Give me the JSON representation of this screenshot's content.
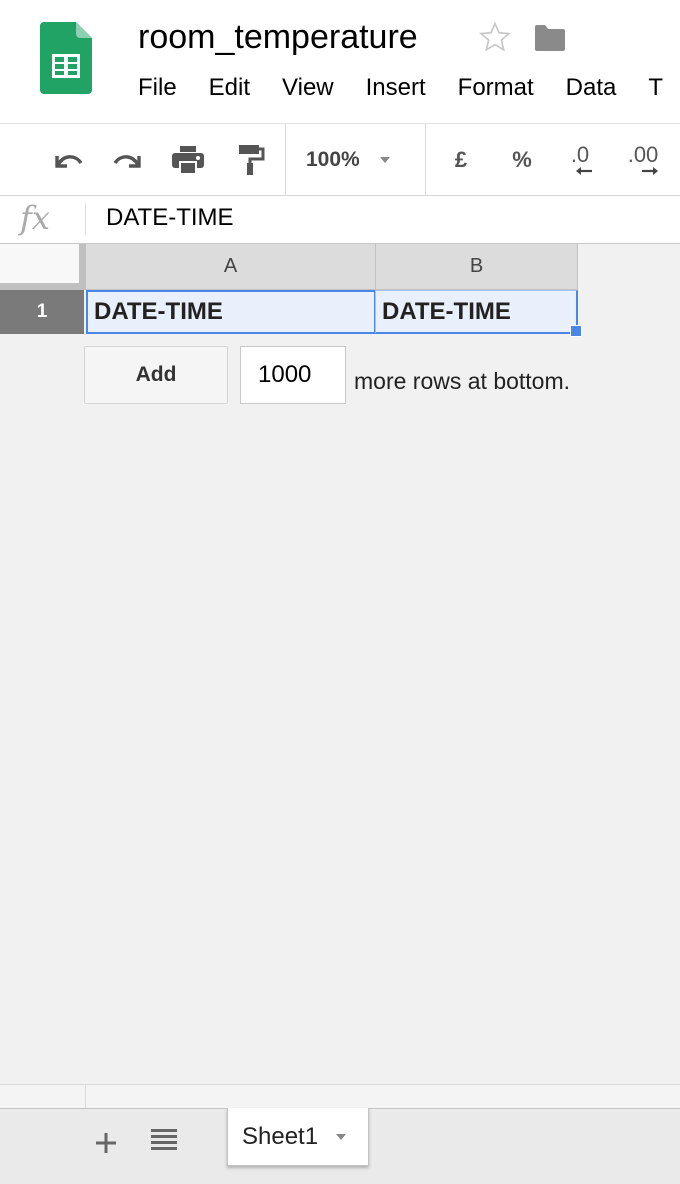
{
  "header": {
    "title": "room_temperature",
    "icons": {
      "logo": "sheets-logo-icon",
      "star": "star-icon",
      "folder": "folder-icon"
    },
    "menu": [
      "File",
      "Edit",
      "View",
      "Insert",
      "Format",
      "Data",
      "T"
    ]
  },
  "toolbar": {
    "icons": [
      "undo-icon",
      "redo-icon",
      "print-icon",
      "paint-format-icon"
    ],
    "zoom": "100%",
    "currency_label": "£",
    "percent_label": "%",
    "decrease_decimal_label": ".0",
    "increase_decimal_label": ".00"
  },
  "formula_bar": {
    "fx_label": "fx",
    "value": "DATE-TIME"
  },
  "grid": {
    "columns": [
      "A",
      "B"
    ],
    "rows": [
      {
        "header": "1",
        "cells": [
          "DATE-TIME",
          "DATE-TIME"
        ]
      }
    ]
  },
  "add_rows": {
    "button_label": "Add",
    "count": "1000",
    "suffix": "more rows at bottom."
  },
  "sheets": {
    "add_icon": "plus-icon",
    "list_icon": "list-icon",
    "tabs": [
      {
        "label": "Sheet1"
      }
    ]
  },
  "colors": {
    "accent": "#4a86e8",
    "logo": "#0f9d58",
    "selection_fill": "#e9f0fc"
  }
}
